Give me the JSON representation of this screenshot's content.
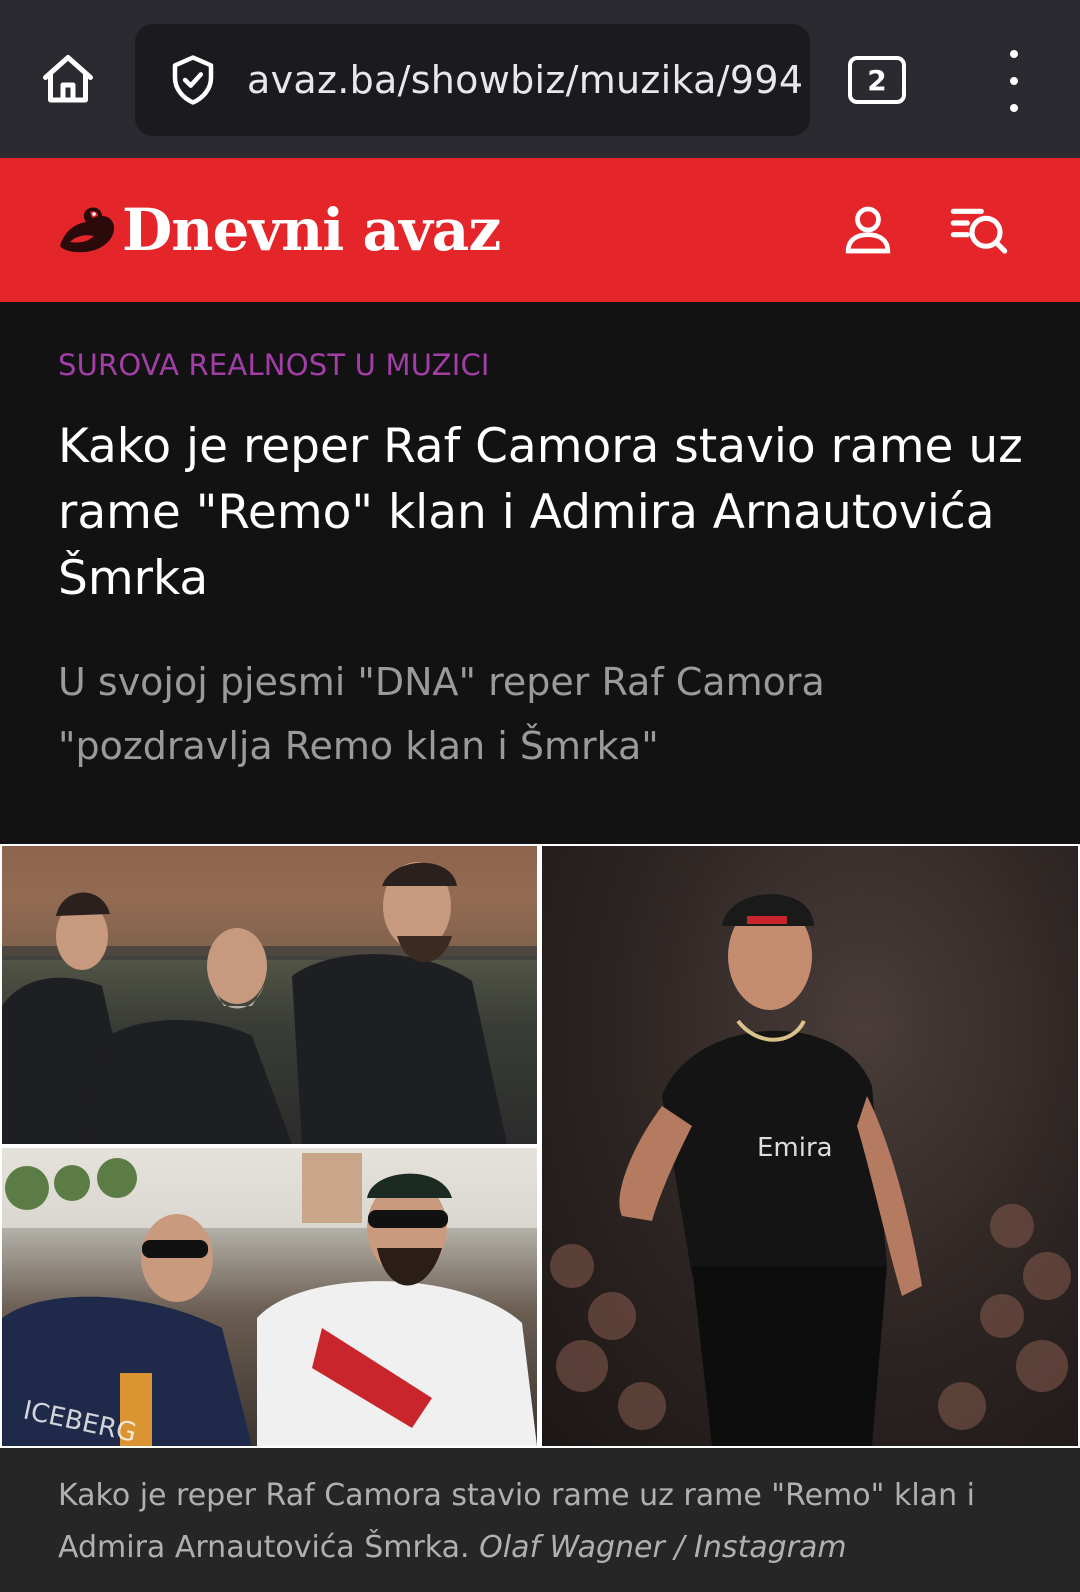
{
  "browser": {
    "url": "avaz.ba/showbiz/muzika/994",
    "tab_count": "2",
    "icons": {
      "home": "home-icon",
      "security": "shield-check-icon",
      "menu": "more-vertical-icon"
    }
  },
  "site": {
    "logo_text": "Dnevni avaz",
    "brand_color": "#e4262a",
    "icons": {
      "user": "user-icon",
      "search": "search-menu-icon"
    }
  },
  "article": {
    "kicker": "SUROVA REALNOST U MUZICI",
    "kicker_color": "#a23ea6",
    "headline": "Kako je reper Raf Camora stavio rame uz rame \"Remo\" klan i Admira Arnautovića Šmrka",
    "lead": "U svojoj pjesmi \"DNA\" reper Raf Camora \"pozdravlja Remo klan i Šmrka\""
  },
  "image": {
    "caption": "Kako je reper Raf Camora stavio rame uz rame \"Remo\" klan i Admira Arnautovića Šmrka.",
    "credit": "Olaf Wagner / Instagram"
  }
}
